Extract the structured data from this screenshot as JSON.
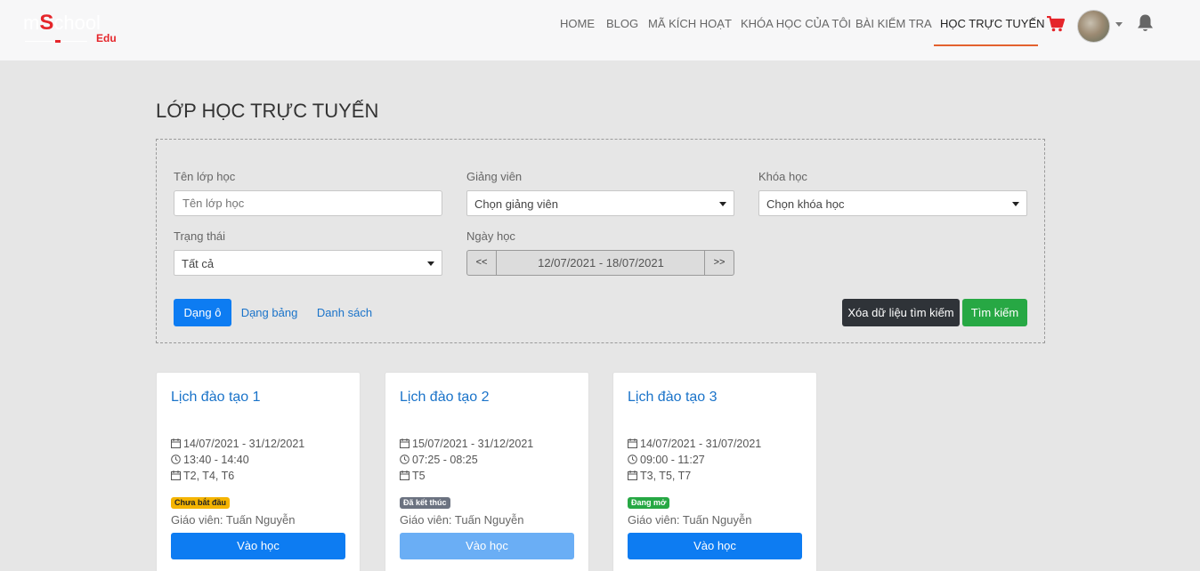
{
  "header": {
    "logo": {
      "part1": "m",
      "part2": "S",
      "part3": "chool",
      "part4": "Edu"
    },
    "nav": [
      {
        "label": "HOME",
        "active": false
      },
      {
        "label": "BLOG",
        "active": false
      },
      {
        "label": "MÃ KÍCH HOẠT",
        "active": false
      },
      {
        "label": "KHÓA HỌC CỦA TÔI",
        "active": false
      },
      {
        "label": "BÀI KIỂM TRA",
        "active": false
      },
      {
        "label": "HỌC TRỰC TUYẾN",
        "active": true
      }
    ],
    "icons": [
      "cart-icon",
      "avatar",
      "chevron-down-icon",
      "bell-icon"
    ],
    "accent_color": "#e3612e"
  },
  "page": {
    "title": "LỚP HỌC TRỰC TUYẾN"
  },
  "filter": {
    "class_name": {
      "label": "Tên lớp học",
      "placeholder": "Tên lớp học"
    },
    "teacher": {
      "label": "Giảng viên",
      "value": "Chọn giảng viên"
    },
    "course": {
      "label": "Khóa học",
      "value": "Chọn khóa học"
    },
    "status": {
      "label": "Trạng thái",
      "value": "Tất cả"
    },
    "date": {
      "label": "Ngày học",
      "prev": "<<",
      "range": "12/07/2021 - 18/07/2021",
      "next": ">>"
    },
    "views": {
      "grid": "Dạng ô",
      "table": "Dạng bảng",
      "list": "Danh sách"
    },
    "clear_label": "Xóa dữ liệu tìm kiếm",
    "search_label": "Tìm kiếm"
  },
  "cards": [
    {
      "title": "Lịch đào tạo 1",
      "dates": "14/07/2021 - 31/12/2021",
      "time": "13:40 - 14:40",
      "days": "T2, T4, T6",
      "status": "Chưa bắt đầu",
      "status_color": "#f5b400",
      "teacher": "Giáo viên: Tuấn Nguyễn",
      "button": "Vào học",
      "enabled": true
    },
    {
      "title": "Lịch đào tạo 2",
      "dates": "15/07/2021 - 31/12/2021",
      "time": "07:25 - 08:25",
      "days": "T5",
      "status": "Đã kết thúc",
      "status_color": "#6b7280",
      "teacher": "Giáo viên: Tuấn Nguyễn",
      "button": "Vào học",
      "enabled": false
    },
    {
      "title": "Lịch đào tạo 3",
      "dates": "14/07/2021 - 31/07/2021",
      "time": "09:00 - 11:27",
      "days": "T3, T5, T7",
      "status": "Đang mở",
      "status_color": "#27a844",
      "teacher": "Giáo viên: Tuấn Nguyễn",
      "button": "Vào học",
      "enabled": true
    }
  ]
}
